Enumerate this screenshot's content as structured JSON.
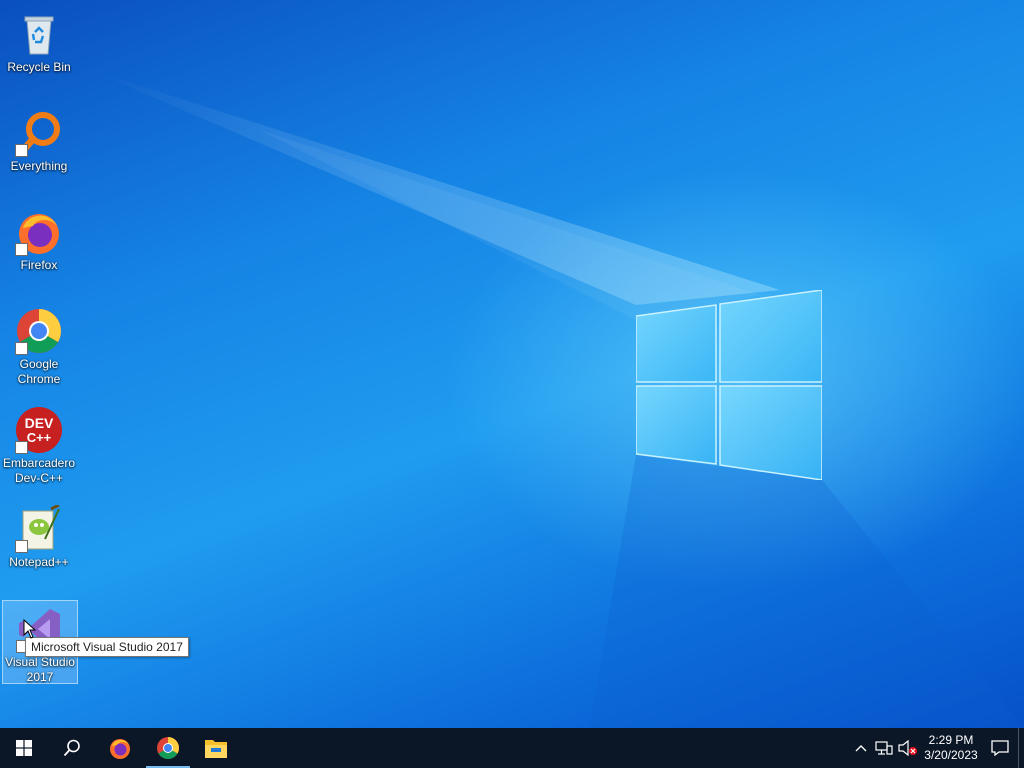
{
  "desktop": {
    "icons": [
      {
        "label": "Recycle Bin",
        "icon": "recycle-bin-icon"
      },
      {
        "label": "Everything",
        "icon": "everything-search-icon"
      },
      {
        "label": "Firefox",
        "icon": "firefox-icon"
      },
      {
        "label": "Google\nChrome",
        "icon": "chrome-icon"
      },
      {
        "label": "Embarcadero\nDev-C++",
        "icon": "devcpp-icon"
      },
      {
        "label": "Notepad++",
        "icon": "notepadpp-icon"
      },
      {
        "label": "Visual Studio\n2017",
        "icon": "visual-studio-icon"
      }
    ],
    "tooltip": "Microsoft Visual Studio 2017",
    "devcpp_text_top": "DEV",
    "devcpp_text_bottom": "C++"
  },
  "taskbar": {
    "buttons": [
      {
        "icon": "windows-start-icon"
      },
      {
        "icon": "search-icon"
      },
      {
        "icon": "firefox-icon"
      },
      {
        "icon": "chrome-icon",
        "active": true
      },
      {
        "icon": "file-explorer-icon"
      }
    ],
    "tray": {
      "time": "2:29 PM",
      "date": "3/20/2023",
      "icons": [
        "chevron-up-icon",
        "network-icon",
        "volume-muted-icon",
        "action-center-icon"
      ]
    }
  },
  "colors": {
    "taskbar_bg": "#0b1626",
    "desktop_accent": "#1f9cf0",
    "active_indicator": "#76b9ed"
  }
}
